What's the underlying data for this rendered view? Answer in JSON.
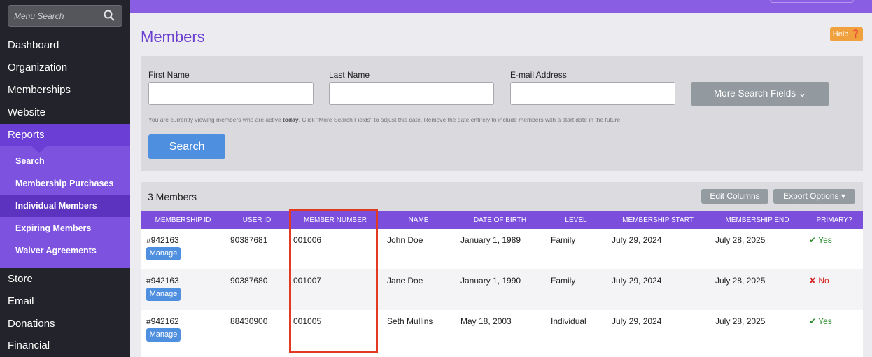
{
  "sidebar": {
    "search_placeholder": "Menu Search",
    "items": [
      {
        "label": "Dashboard"
      },
      {
        "label": "Organization"
      },
      {
        "label": "Memberships"
      },
      {
        "label": "Website"
      },
      {
        "label": "Reports"
      }
    ],
    "subitems": [
      {
        "label": "Search"
      },
      {
        "label": "Membership Purchases"
      },
      {
        "label": "Individual Members"
      },
      {
        "label": "Expiring Members"
      },
      {
        "label": "Waiver Agreements"
      }
    ],
    "bottom_items": [
      {
        "label": "Store"
      },
      {
        "label": "Email"
      },
      {
        "label": "Donations"
      },
      {
        "label": "Financial"
      }
    ]
  },
  "page": {
    "title": "Members",
    "help_label": "Help ❓"
  },
  "search": {
    "first_name_label": "First Name",
    "last_name_label": "Last Name",
    "email_label": "E-mail Address",
    "more_fields_label": "More Search Fields ⌄",
    "hint_pre": "You are currently viewing members who are active ",
    "hint_bold": "today",
    "hint_post": ". Click \"More Search Fields\" to adjust this date. Remove the date entirely to include members with a start date in the future.",
    "search_label": "Search"
  },
  "results": {
    "count_label": "3 Members",
    "edit_columns_label": "Edit Columns",
    "export_label": "Export Options ▾",
    "columns": [
      "MEMBERSHIP ID",
      "USER ID",
      "MEMBER NUMBER",
      "NAME",
      "DATE OF BIRTH",
      "LEVEL",
      "MEMBERSHIP START",
      "MEMBERSHIP END",
      "PRIMARY?"
    ],
    "manage_label": "Manage",
    "rows": [
      {
        "membership_id": "#942163",
        "user_id": "90387681",
        "member_number": "001006",
        "name": "John Doe",
        "dob": "January 1, 1989",
        "level": "Family",
        "start": "July 29, 2024",
        "end": "July 28, 2025",
        "primary": "✔ Yes"
      },
      {
        "membership_id": "#942163",
        "user_id": "90387680",
        "member_number": "001007",
        "name": "Jane Doe",
        "dob": "January 1, 1990",
        "level": "Family",
        "start": "July 29, 2024",
        "end": "July 28, 2025",
        "primary": "✘ No"
      },
      {
        "membership_id": "#942162",
        "user_id": "88430900",
        "member_number": "001005",
        "name": "Seth Mullins",
        "dob": "May 18, 2003",
        "level": "Individual",
        "start": "July 29, 2024",
        "end": "July 28, 2025",
        "primary": "✔ Yes"
      }
    ]
  },
  "colors": {
    "accent": "#7b4fdc",
    "sidebar": "#23232b",
    "button_blue": "#4f8fe0",
    "highlight": "#e23a22"
  }
}
